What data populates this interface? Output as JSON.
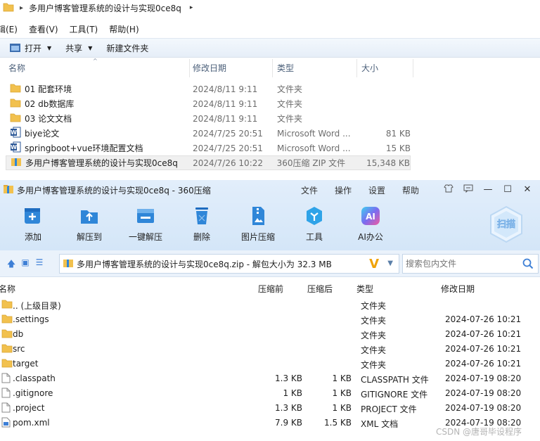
{
  "explorer": {
    "title": "多用户博客管理系统的设计与实现0ce8q",
    "menu": [
      "辑(E)",
      "查看(V)",
      "工具(T)",
      "帮助(H)"
    ],
    "toolbar": {
      "open": "打开",
      "share": "共享",
      "new_folder": "新建文件夹"
    },
    "columns": {
      "name": "名称",
      "date": "修改日期",
      "type": "类型",
      "size": "大小"
    },
    "rows": [
      {
        "name": "01 配套环境",
        "date": "2024/8/11 9:11",
        "type": "文件夹",
        "size": "",
        "icon": "folder-icon"
      },
      {
        "name": "02 db数据库",
        "date": "2024/8/11 9:11",
        "type": "文件夹",
        "size": "",
        "icon": "folder-icon"
      },
      {
        "name": "03 论文文档",
        "date": "2024/8/11 9:11",
        "type": "文件夹",
        "size": "",
        "icon": "folder-icon"
      },
      {
        "name": "biye论文",
        "date": "2024/7/25 20:51",
        "type": "Microsoft Word ...",
        "size": "81 KB",
        "icon": "word-doc-icon"
      },
      {
        "name": "springboot+vue环境配置文档",
        "date": "2024/7/25 20:51",
        "type": "Microsoft Word ...",
        "size": "15 KB",
        "icon": "word-doc-icon"
      },
      {
        "name": "多用户博客管理系统的设计与实现0ce8q",
        "date": "2024/7/26 10:22",
        "type": "360压缩 ZIP 文件",
        "size": "15,348 KB",
        "icon": "zip-archive-icon"
      }
    ]
  },
  "zip_window": {
    "title": "多用户博客管理系统的设计与实现0ce8q - 360压缩",
    "menu": [
      "文件",
      "操作",
      "设置",
      "帮助"
    ],
    "tools": [
      {
        "label": "添加",
        "icon": "add-icon"
      },
      {
        "label": "解压到",
        "icon": "extract-to-icon"
      },
      {
        "label": "一键解压",
        "icon": "one-click-extract-icon"
      },
      {
        "label": "删除",
        "icon": "delete-icon"
      },
      {
        "label": "图片压缩",
        "icon": "image-compress-icon"
      },
      {
        "label": "工具",
        "icon": "tools-icon"
      },
      {
        "label": "AI办公",
        "icon": "ai-office-icon"
      }
    ],
    "scan_label": "扫描",
    "address": "多用户博客管理系统的设计与实现0ce8q.zip - 解包大小为 32.3 MB",
    "search_placeholder": "搜索包内文件",
    "columns": {
      "name": "名称",
      "original": "压缩前",
      "compressed": "压缩后",
      "type": "类型",
      "date": "修改日期"
    },
    "rows": [
      {
        "name": ".. (上级目录)",
        "original": "",
        "compressed": "",
        "type": "文件夹",
        "date": "",
        "icon": "folder-icon"
      },
      {
        "name": ".settings",
        "original": "",
        "compressed": "",
        "type": "文件夹",
        "date": "2024-07-26 10:21",
        "icon": "folder-icon"
      },
      {
        "name": "db",
        "original": "",
        "compressed": "",
        "type": "文件夹",
        "date": "2024-07-26 10:21",
        "icon": "folder-icon"
      },
      {
        "name": "src",
        "original": "",
        "compressed": "",
        "type": "文件夹",
        "date": "2024-07-26 10:21",
        "icon": "folder-icon"
      },
      {
        "name": "target",
        "original": "",
        "compressed": "",
        "type": "文件夹",
        "date": "2024-07-26 10:21",
        "icon": "folder-icon"
      },
      {
        "name": ".classpath",
        "original": "1.3 KB",
        "compressed": "1 KB",
        "type": "CLASSPATH 文件",
        "date": "2024-07-19 08:20",
        "icon": "file-icon"
      },
      {
        "name": ".gitignore",
        "original": "1 KB",
        "compressed": "1 KB",
        "type": "GITIGNORE 文件",
        "date": "2024-07-19 08:20",
        "icon": "file-icon"
      },
      {
        "name": ".project",
        "original": "1.3 KB",
        "compressed": "1 KB",
        "type": "PROJECT 文件",
        "date": "2024-07-19 08:20",
        "icon": "file-icon"
      },
      {
        "name": "pom.xml",
        "original": "7.9 KB",
        "compressed": "1.5 KB",
        "type": "XML 文档",
        "date": "2024-07-19 08:20",
        "icon": "xml-file-icon"
      }
    ]
  },
  "watermark": "CSDN @唐哥毕设程序",
  "colors": {
    "folder": "#f2c14e",
    "accent": "#2f86d8",
    "word": "#2b5797"
  }
}
